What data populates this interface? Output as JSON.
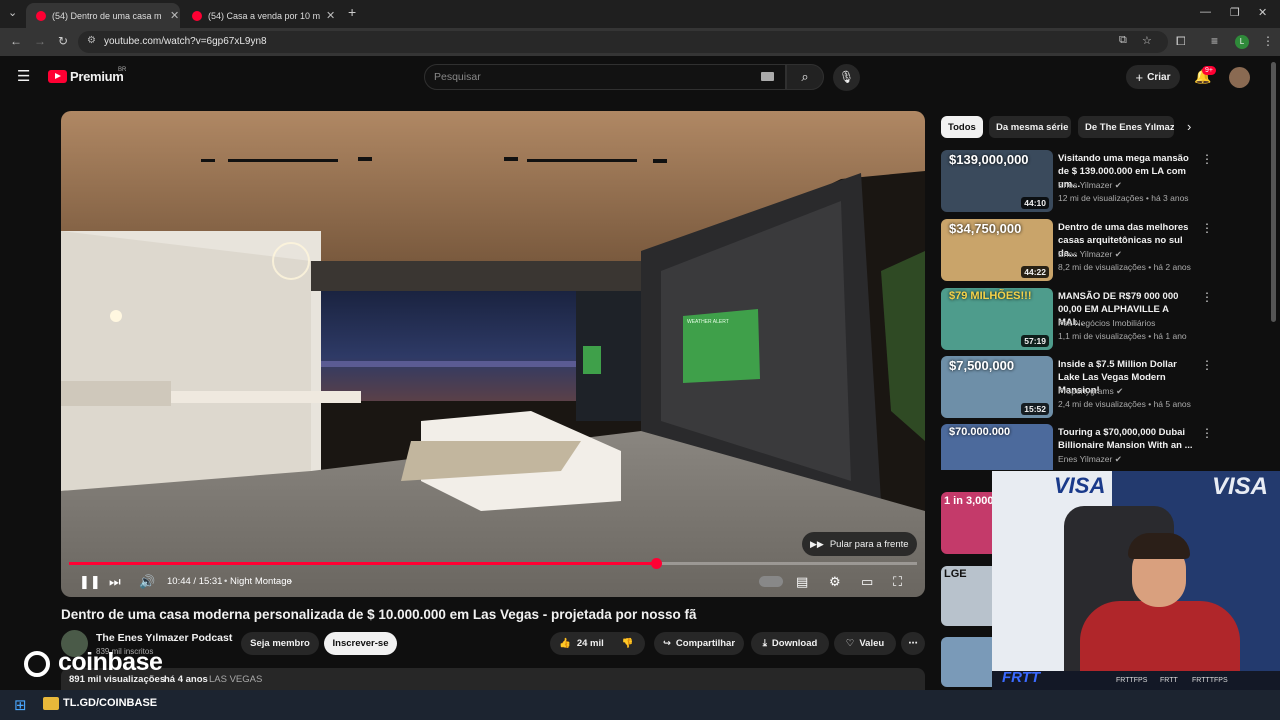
{
  "browser": {
    "tabs": [
      {
        "label": "(54) Dentro de uma casa m",
        "active": true
      },
      {
        "label": "(54) Casa a venda por 10 milhõ",
        "active": false
      }
    ],
    "url": "youtube.com/watch?v=6gp67xL9yn8",
    "profile_initial": "L"
  },
  "header": {
    "brand": "Premium",
    "brand_region": "BR",
    "search_placeholder": "Pesquisar",
    "create_label": "Criar",
    "notification_badge": "9+"
  },
  "player": {
    "time": "10:44 / 15:31",
    "chapter": "Night Montage",
    "skip_label": "Pular para a frente",
    "progress_fraction": 0.692,
    "tv_text": "WEATHER ALERT"
  },
  "video": {
    "title": "Dentro de uma casa moderna personalizada de $ 10.000.000 em Las Vegas - projetada por nosso fã",
    "channel": "The Enes Yılmazer Podcast",
    "subscribers": "839 mil inscritos",
    "join_label": "Seja membro",
    "subscribe_label": "Inscrever-se",
    "likes": "24 mil",
    "share_label": "Compartilhar",
    "download_label": "Download",
    "thanks_label": "Valeu",
    "views": "891 mil visualizações",
    "age": "há 4 anos",
    "tag": "LAS VEGAS"
  },
  "sidebar": {
    "chips": [
      "Todos",
      "Da mesma série",
      "De The Enes Yılmazer"
    ],
    "items": [
      {
        "price": "$139,000,000",
        "duration": "44:10",
        "title": "Visitando uma mega mansão de $ 139.000.000 em LA com um...",
        "channel": "Enes Yilmazer",
        "meta": "12 mi de visualizações • há 3 anos",
        "color": "#3a4a5c"
      },
      {
        "price": "$34,750,000",
        "duration": "44:22",
        "title": "Dentro de uma das melhores casas arquitetônicas no sul da...",
        "channel": "Enes Yilmazer",
        "meta": "8,2 mi de visualizações • há 2 anos",
        "color": "#c9a46a"
      },
      {
        "price": "$79 MILHÕES!!!",
        "duration": "57:19",
        "title": "MANSÃO DE R$79 000 000 00,00 EM ALPHAVILLE A MAI...",
        "channel": "Felt Negócios Imobiliários",
        "meta": "1,1 mi de visualizações • há 1 ano",
        "color": "#4e9c8c"
      },
      {
        "price": "$7,500,000",
        "duration": "15:52",
        "title": "Inside a $7.5 Million Dollar Lake Las Vegas Modern Mansion!",
        "channel": "Propertygrams",
        "meta": "2,4 mi de visualizações • há 5 anos",
        "color": "#6e8fa8"
      },
      {
        "price": "$70.000.000",
        "duration": "",
        "title": "Touring a $70,000,000 Dubai Billionaire Mansion With an ...",
        "channel": "Enes Yilmazer",
        "meta": "",
        "color": "#4c6a9c"
      }
    ],
    "extra_thumb_text": "1 in 3,000",
    "extra_thumb2_text": "LGE"
  },
  "overlay": {
    "sponsor": "coinbase",
    "sponsor_link": "TL.GD/COINBASE",
    "webcam_text": [
      "VISA",
      "VISA"
    ],
    "webcam_tags": [
      "FRTTFPS",
      "FRTT",
      "FRTTTFPS"
    ]
  },
  "colors": {
    "accent": "#ff0033",
    "bg": "#0f0f0f"
  }
}
